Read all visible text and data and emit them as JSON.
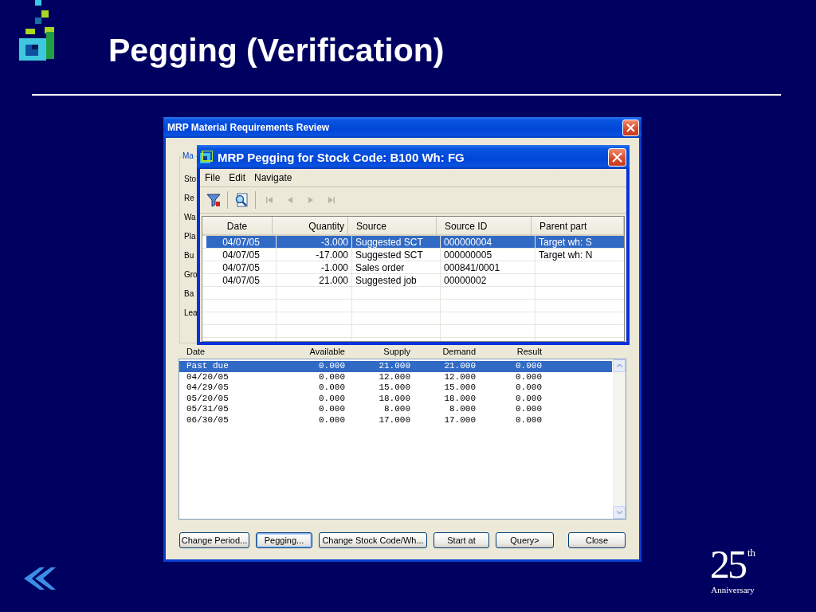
{
  "slide": {
    "title": "Pegging (Verification)",
    "anniversary": {
      "number": "25",
      "suffix": "th",
      "caption": "Anniversary"
    }
  },
  "review_window": {
    "title": "MRP Material Requirements Review",
    "group_title": "Ma",
    "field_labels": [
      "Sto",
      "Re",
      "Wa",
      "Pla",
      "Bu",
      "Gro",
      "Ba",
      "Lea"
    ],
    "table": {
      "columns": [
        "Date",
        "Available",
        "Supply",
        "Demand",
        "Result"
      ],
      "rows": [
        {
          "date": "Past due",
          "available": "0.000",
          "supply": "21.000",
          "demand": "21.000",
          "result": "0.000",
          "selected": true
        },
        {
          "date": "04/20/05",
          "available": "0.000",
          "supply": "12.000",
          "demand": "12.000",
          "result": "0.000",
          "selected": false
        },
        {
          "date": "04/29/05",
          "available": "0.000",
          "supply": "15.000",
          "demand": "15.000",
          "result": "0.000",
          "selected": false
        },
        {
          "date": "05/20/05",
          "available": "0.000",
          "supply": "18.000",
          "demand": "18.000",
          "result": "0.000",
          "selected": false
        },
        {
          "date": "05/31/05",
          "available": "0.000",
          "supply": "8.000",
          "demand": "8.000",
          "result": "0.000",
          "selected": false
        },
        {
          "date": "06/30/05",
          "available": "0.000",
          "supply": "17.000",
          "demand": "17.000",
          "result": "0.000",
          "selected": false
        }
      ]
    },
    "buttons": [
      {
        "label": "Change Period...",
        "focused": false
      },
      {
        "label": "Pegging...",
        "focused": true
      },
      {
        "label": "Change Stock Code/Wh...",
        "focused": false
      },
      {
        "label": "Start at",
        "focused": false
      },
      {
        "label": "Query>",
        "focused": false
      },
      {
        "label": "Close",
        "focused": false
      }
    ]
  },
  "pegging_window": {
    "title": "MRP Pegging for Stock Code: B100 Wh: FG",
    "menu": [
      "File",
      "Edit",
      "Navigate"
    ],
    "toolbar": [
      {
        "kind": "filter",
        "disabled": false
      },
      {
        "kind": "find",
        "disabled": false
      },
      {
        "kind": "first",
        "disabled": true
      },
      {
        "kind": "previous",
        "disabled": true
      },
      {
        "kind": "next",
        "disabled": true
      },
      {
        "kind": "last",
        "disabled": true
      }
    ],
    "table": {
      "columns": [
        "Date",
        "Quantity",
        "Source",
        "Source ID",
        "Parent part"
      ],
      "rows": [
        {
          "date": "04/07/05",
          "quantity": "-3.000",
          "source": "Suggested SCT",
          "source_id": "000000004",
          "parent_part": "Target wh: S",
          "selected": true
        },
        {
          "date": "04/07/05",
          "quantity": "-17.000",
          "source": "Suggested SCT",
          "source_id": "000000005",
          "parent_part": "Target wh: N",
          "selected": false
        },
        {
          "date": "04/07/05",
          "quantity": "-1.000",
          "source": "Sales order",
          "source_id": "000841/0001",
          "selected": false
        },
        {
          "date": "04/07/05",
          "quantity": "21.000",
          "source": "Suggested job",
          "source_id": "00000002",
          "selected": false
        }
      ]
    }
  }
}
